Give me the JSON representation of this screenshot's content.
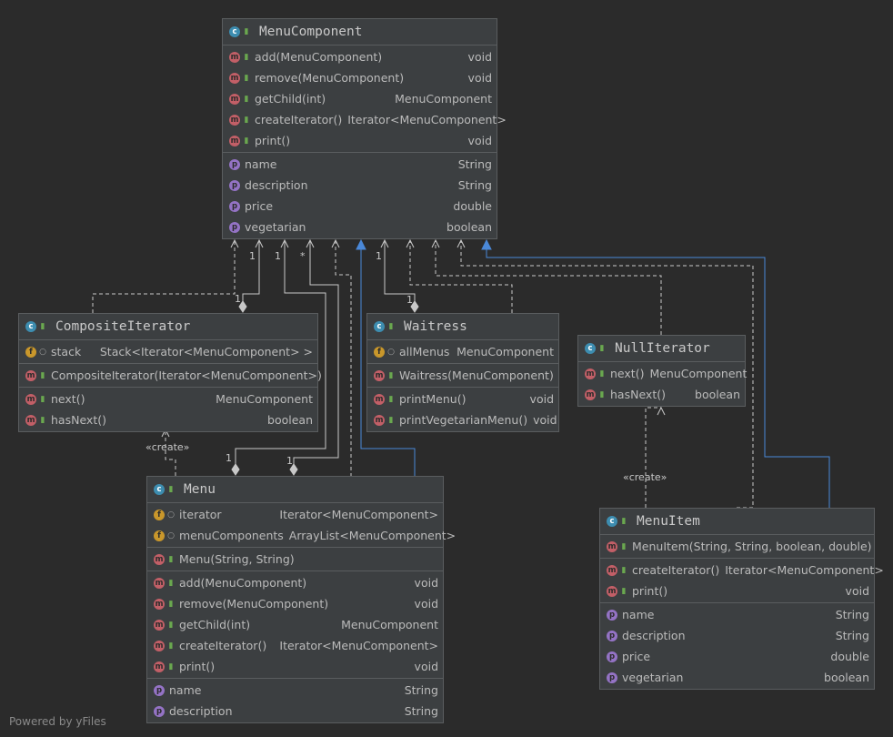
{
  "classes": {
    "menu_component": {
      "name": "MenuComponent",
      "sections": [
        [
          {
            "kind": "m",
            "vis": "pub",
            "name": "add(MenuComponent)",
            "type": "void"
          },
          {
            "kind": "m",
            "vis": "pub",
            "name": "remove(MenuComponent)",
            "type": "void"
          },
          {
            "kind": "m",
            "vis": "pub",
            "name": "getChild(int)",
            "type": "MenuComponent"
          },
          {
            "kind": "m",
            "vis": "pub",
            "name": "createIterator()",
            "type": "Iterator<MenuComponent>"
          },
          {
            "kind": "m",
            "vis": "pub",
            "name": "print()",
            "type": "void"
          }
        ],
        [
          {
            "kind": "p",
            "vis": "",
            "name": "name",
            "type": "String"
          },
          {
            "kind": "p",
            "vis": "",
            "name": "description",
            "type": "String"
          },
          {
            "kind": "p",
            "vis": "",
            "name": "price",
            "type": "double"
          },
          {
            "kind": "p",
            "vis": "",
            "name": "vegetarian",
            "type": "boolean"
          }
        ]
      ]
    },
    "composite_iterator": {
      "name": "CompositeIterator",
      "sections": [
        [
          {
            "kind": "f",
            "vis": "pkg",
            "name": "stack",
            "type": "Stack<Iterator<MenuComponent> >"
          }
        ],
        [
          {
            "kind": "m",
            "vis": "pub",
            "name": "CompositeIterator(Iterator<MenuComponent>)",
            "type": ""
          }
        ],
        [
          {
            "kind": "m",
            "vis": "pub",
            "name": "next()",
            "type": "MenuComponent"
          },
          {
            "kind": "m",
            "vis": "pub",
            "name": "hasNext()",
            "type": "boolean"
          }
        ]
      ]
    },
    "waitress": {
      "name": "Waitress",
      "sections": [
        [
          {
            "kind": "f",
            "vis": "pkg",
            "name": "allMenus",
            "type": "MenuComponent"
          }
        ],
        [
          {
            "kind": "m",
            "vis": "pub",
            "name": "Waitress(MenuComponent)",
            "type": ""
          }
        ],
        [
          {
            "kind": "m",
            "vis": "pub",
            "name": "printMenu()",
            "type": "void"
          },
          {
            "kind": "m",
            "vis": "pub",
            "name": "printVegetarianMenu()",
            "type": "void"
          }
        ]
      ]
    },
    "null_iterator": {
      "name": "NullIterator",
      "sections": [
        [
          {
            "kind": "m",
            "vis": "pub",
            "name": "next()",
            "type": "MenuComponent"
          },
          {
            "kind": "m",
            "vis": "pub",
            "name": "hasNext()",
            "type": "boolean"
          }
        ]
      ]
    },
    "menu": {
      "name": "Menu",
      "sections": [
        [
          {
            "kind": "f",
            "vis": "pkg",
            "name": "iterator",
            "type": "Iterator<MenuComponent>"
          },
          {
            "kind": "f",
            "vis": "pkg",
            "name": "menuComponents",
            "type": "ArrayList<MenuComponent>"
          }
        ],
        [
          {
            "kind": "m",
            "vis": "pub",
            "name": "Menu(String, String)",
            "type": ""
          }
        ],
        [
          {
            "kind": "m",
            "vis": "pub",
            "name": "add(MenuComponent)",
            "type": "void"
          },
          {
            "kind": "m",
            "vis": "pub",
            "name": "remove(MenuComponent)",
            "type": "void"
          },
          {
            "kind": "m",
            "vis": "pub",
            "name": "getChild(int)",
            "type": "MenuComponent"
          },
          {
            "kind": "m",
            "vis": "pub",
            "name": "createIterator()",
            "type": "Iterator<MenuComponent>"
          },
          {
            "kind": "m",
            "vis": "pub",
            "name": "print()",
            "type": "void"
          }
        ],
        [
          {
            "kind": "p",
            "vis": "",
            "name": "name",
            "type": "String"
          },
          {
            "kind": "p",
            "vis": "",
            "name": "description",
            "type": "String"
          }
        ]
      ]
    },
    "menu_item": {
      "name": "MenuItem",
      "sections": [
        [
          {
            "kind": "m",
            "vis": "pub",
            "name": "MenuItem(String, String, boolean, double)",
            "type": ""
          }
        ],
        [
          {
            "kind": "m",
            "vis": "pub",
            "name": "createIterator()",
            "type": "Iterator<MenuComponent>"
          },
          {
            "kind": "m",
            "vis": "pub",
            "name": "print()",
            "type": "void"
          }
        ],
        [
          {
            "kind": "p",
            "vis": "",
            "name": "name",
            "type": "String"
          },
          {
            "kind": "p",
            "vis": "",
            "name": "description",
            "type": "String"
          },
          {
            "kind": "p",
            "vis": "",
            "name": "price",
            "type": "double"
          },
          {
            "kind": "p",
            "vis": "",
            "name": "vegetarian",
            "type": "boolean"
          }
        ]
      ]
    }
  },
  "labels": {
    "create_composite": "«create»",
    "create_null": "«create»",
    "mult_ci_one": "1",
    "mult_ci_diamond": "1",
    "mult_menu_one": "1",
    "mult_menu_star": "*",
    "mult_menu_diamond_a": "1",
    "mult_menu_diamond_b": "1",
    "mult_waitress_one": "1",
    "mult_waitress_diamond": "1"
  },
  "colors": {
    "background": "#2b2b2b",
    "box": "#3c3f41",
    "dependency_line": "#c8c8c8",
    "inheritance_line": "#4a88d8"
  },
  "footer": {
    "watermark": "Powered by yFiles"
  }
}
